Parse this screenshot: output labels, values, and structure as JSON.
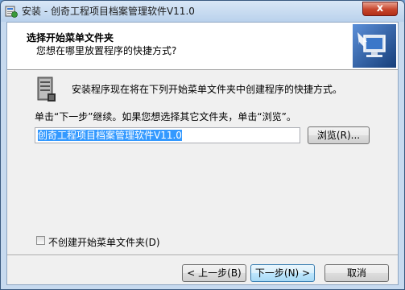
{
  "window": {
    "title": "安装 - 创奇工程项目档案管理软件V11.0",
    "close_glyph": "x"
  },
  "header": {
    "title": "选择开始菜单文件夹",
    "subtitle": "您想在哪里放置程序的快捷方式?"
  },
  "body": {
    "intro": "安装程序现在将在下列开始菜单文件夹中创建程序的快捷方式。",
    "instruction": "单击“下一步”继续。如果您想选择其它文件夹，单击“浏览”。",
    "folder_value": "创奇工程项目档案管理软件V11.0",
    "browse_label": "浏览(R)...",
    "no_folder_checkbox_label": "不创建开始菜单文件夹(D)",
    "no_folder_checked": false
  },
  "footer": {
    "back_label": "< 上一步(B)",
    "next_label": "下一步(N) >",
    "cancel_label": "取消"
  },
  "colors": {
    "selection": "#3399ff",
    "frame": "#c7daef",
    "close": "#c7452c"
  }
}
